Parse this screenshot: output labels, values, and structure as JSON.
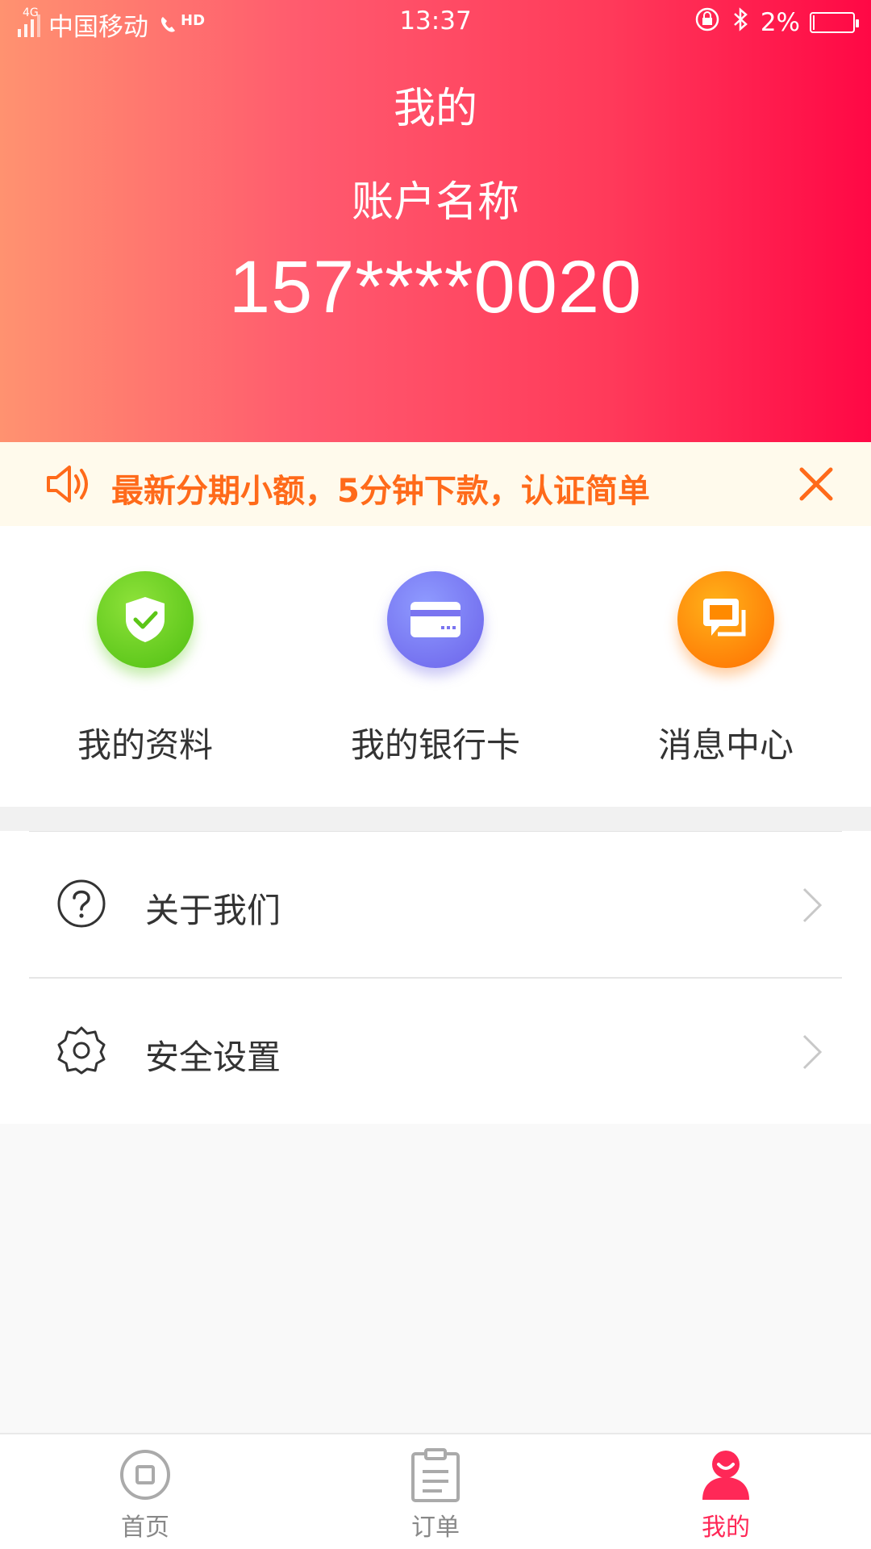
{
  "status_bar": {
    "network": "4G",
    "carrier": "中国移动",
    "call_badge": "HD",
    "time": "13:37",
    "battery": "2%"
  },
  "header": {
    "title": "我的",
    "account_label": "账户名称",
    "account_number": "157****0020"
  },
  "notice": {
    "text": "最新分期小额，5分钟下款，认证简单",
    "icon": "speaker-icon",
    "close_icon": "close-icon"
  },
  "quick_actions": [
    {
      "label": "我的资料",
      "icon": "shield-check-icon"
    },
    {
      "label": "我的银行卡",
      "icon": "bank-card-icon"
    },
    {
      "label": "消息中心",
      "icon": "message-icon"
    }
  ],
  "menu": [
    {
      "label": "关于我们",
      "icon": "question-icon"
    },
    {
      "label": "安全设置",
      "icon": "gear-icon"
    }
  ],
  "tabbar": {
    "items": [
      {
        "label": "首页",
        "icon": "home-icon"
      },
      {
        "label": "订单",
        "icon": "clipboard-icon"
      },
      {
        "label": "我的",
        "icon": "user-icon"
      }
    ],
    "active": "我的"
  },
  "colors": {
    "header_gradient_start": "#ff9270",
    "header_gradient_end": "#ff0845",
    "notice_text": "#ff6a1a",
    "notice_bg": "#fffaec",
    "active_tab": "#ff2857"
  }
}
